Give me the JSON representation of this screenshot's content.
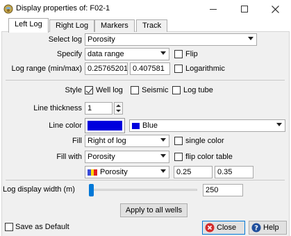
{
  "window": {
    "title": "Display properties of: F02-1"
  },
  "tabs": [
    {
      "label": "Left Log"
    },
    {
      "label": "Right Log"
    },
    {
      "label": "Markers"
    },
    {
      "label": "Track"
    }
  ],
  "form": {
    "select_log_label": "Select log",
    "select_log_value": "Porosity",
    "specify_label": "Specify",
    "specify_value": "data range",
    "flip_label": "Flip",
    "log_range_label": "Log range (min/max)",
    "log_range_min": "0.25765201",
    "log_range_max": "0.407581",
    "logarithmic_label": "Logarithmic",
    "style_label": "Style",
    "style_options": [
      {
        "label": "Well log",
        "checked": true
      },
      {
        "label": "Seismic",
        "checked": false
      },
      {
        "label": "Log tube",
        "checked": false
      }
    ],
    "line_thickness_label": "Line thickness",
    "line_thickness_value": "1",
    "line_color_label": "Line color",
    "line_color_hex": "#0000dd",
    "line_color_name": "Blue",
    "fill_label": "Fill",
    "fill_value": "Right of log",
    "single_color_label": "single color",
    "fill_with_label": "Fill with",
    "fill_with_value": "Porosity",
    "flip_color_table_label": "flip color table",
    "color_table_value": "Porosity",
    "color_range_min": "0.25",
    "color_range_max": "0.35",
    "log_display_width_label": "Log display width (m)",
    "log_display_width_value": "250",
    "apply_all_label": "Apply to all wells",
    "save_default_label": "Save as Default",
    "close_label": "Close",
    "help_label": "Help"
  }
}
